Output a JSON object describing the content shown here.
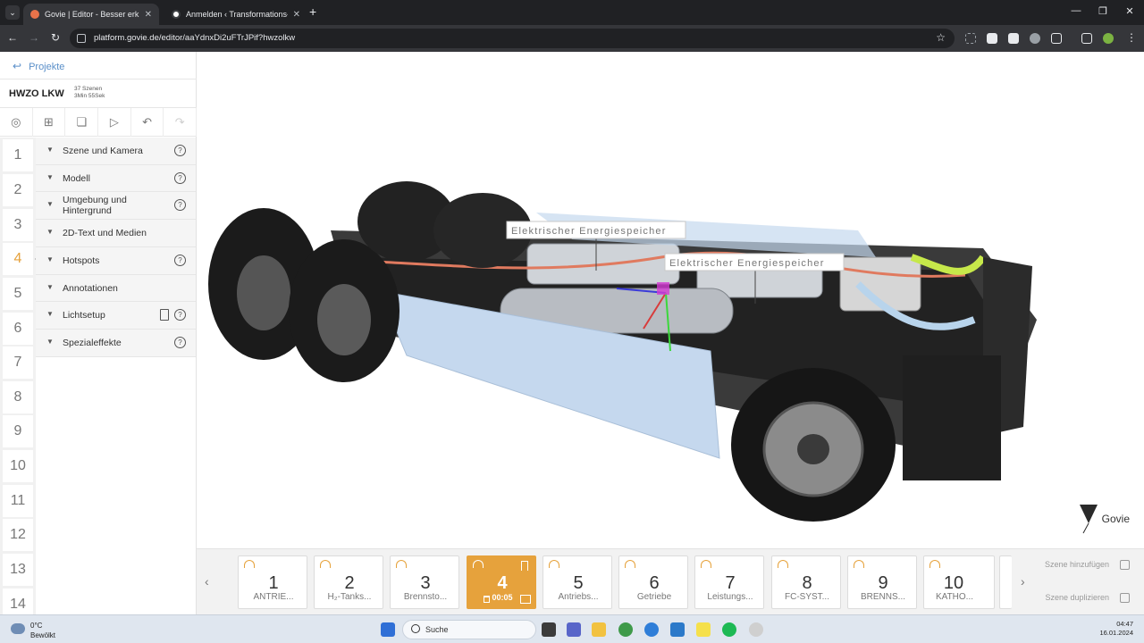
{
  "browser": {
    "tabs": [
      {
        "title": "Govie | Editor - Besser erklären",
        "active": true
      },
      {
        "title": "Anmelden ‹ Transformations-H",
        "active": false
      }
    ],
    "url": "platform.govie.de/editor/aaYdnxDi2uFTrJPif?hwzolkw"
  },
  "sidebar": {
    "back_label": "Projekte",
    "project_name": "HWZO LKW",
    "scene_count": "37 Szenen",
    "duration": "3Min 55Sek",
    "scene_numbers": [
      "1",
      "2",
      "3",
      "4",
      "5",
      "6",
      "7",
      "8",
      "9",
      "10",
      "11",
      "12",
      "13",
      "14"
    ],
    "active_scene": 4,
    "sections": [
      {
        "label": "Szene und Kamera",
        "help": true
      },
      {
        "label": "Modell",
        "help": true
      },
      {
        "label": "Umgebung und Hintergrund",
        "help": true
      },
      {
        "label": "2D-Text und Medien",
        "help": false
      },
      {
        "label": "Hotspots",
        "help": true
      },
      {
        "label": "Annotationen",
        "help": false
      },
      {
        "label": "Lichtsetup",
        "help": true
      },
      {
        "label": "Spezialeffekte",
        "help": true
      }
    ]
  },
  "viewport": {
    "annotations": [
      "Elektrischer Energiespeicher",
      "Elektrischer Energiespeicher"
    ],
    "logo_text": "Govie"
  },
  "scene_strip": {
    "cards": [
      {
        "num": "1",
        "label": "ANTRIE..."
      },
      {
        "num": "2",
        "label": "H₂-Tanks..."
      },
      {
        "num": "3",
        "label": "Brennsto..."
      },
      {
        "num": "4",
        "label": "",
        "duration": "00:05",
        "active": true
      },
      {
        "num": "5",
        "label": "Antriebs..."
      },
      {
        "num": "6",
        "label": "Getriebe"
      },
      {
        "num": "7",
        "label": "Leistungs..."
      },
      {
        "num": "8",
        "label": "FC-SYST..."
      },
      {
        "num": "9",
        "label": "BRENNS..."
      },
      {
        "num": "10",
        "label": "KATHO..."
      }
    ],
    "add_scene": "Szene hinzufügen",
    "duplicate_scene": "Szene duplizieren"
  },
  "taskbar": {
    "temperature": "0°C",
    "weather": "Bewölkt",
    "search": "Suche",
    "time": "04:47",
    "date": "16.01.2024"
  }
}
